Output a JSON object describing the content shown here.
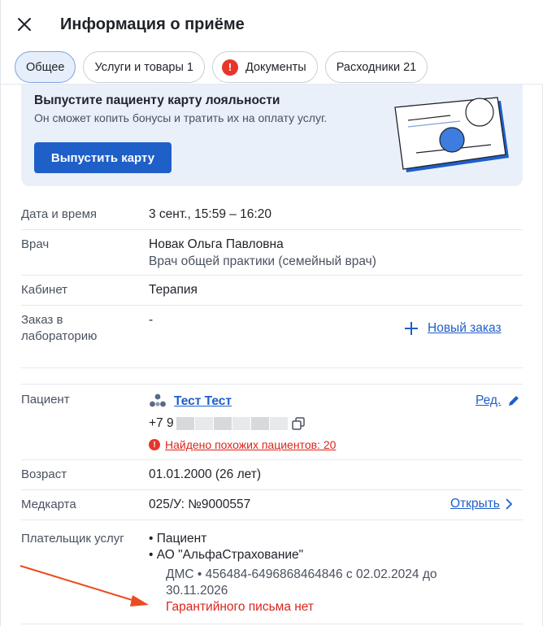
{
  "header": {
    "title": "Информация о приёме"
  },
  "tabs": [
    {
      "label": "Общее",
      "active": true
    },
    {
      "label": "Услуги и товары 1"
    },
    {
      "label": "Документы",
      "warning": "!"
    },
    {
      "label": "Расходники 21"
    }
  ],
  "promo": {
    "title": "Выпустите пациенту карту лояльности",
    "text": "Он сможет копить бонусы и тратить их на оплату услуг.",
    "button": "Выпустить карту"
  },
  "rows": {
    "datetime": {
      "label": "Дата и время",
      "value": "3 сент., 15:59 – 16:20"
    },
    "doctor": {
      "label": "Врач",
      "name": "Новак Ольга Павловна",
      "specialty": "Врач общей практики (семейный врач)"
    },
    "cabinet": {
      "label": "Кабинет",
      "value": "Терапия"
    },
    "lab": {
      "label_line1": "Заказ в",
      "label_line2": "лабораторию",
      "value": "-",
      "action": "Новый заказ"
    },
    "patient": {
      "label": "Пациент",
      "name": "Тест Тест",
      "edit": "Ред.",
      "phone": "+7 9",
      "warning": "Найдено похожих пациентов: 20"
    },
    "age": {
      "label": "Возраст",
      "value": "01.01.2000 (26 лет)"
    },
    "card": {
      "label": "Медкарта",
      "value": "025/У: №9000557",
      "action": "Открыть"
    },
    "payer": {
      "label": "Плательщик услуг",
      "items": [
        "Пациент",
        "АО \"АльфаСтрахование\""
      ],
      "policy_line1": "ДМС • 456484-6496868464846 с 02.02.2024 до",
      "policy_line2": "30.11.2026",
      "guarantee": "Гарантийного письма нет"
    }
  },
  "colors": {
    "accent": "#1f5fc8",
    "danger": "#d9261c",
    "promo_bg": "#eaf0fa",
    "arrow": "#ec4b20"
  }
}
